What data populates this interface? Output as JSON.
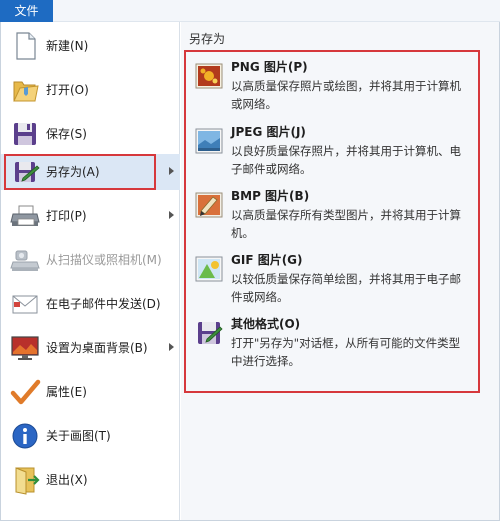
{
  "app": {
    "file_tab": "文件"
  },
  "menu": {
    "items": [
      {
        "label": "新建(N)",
        "icon": "new-document-icon"
      },
      {
        "label": "打开(O)",
        "icon": "folder-open-icon"
      },
      {
        "label": "保存(S)",
        "icon": "floppy-disk-icon"
      },
      {
        "label": "另存为(A)",
        "icon": "save-as-icon"
      },
      {
        "label": "打印(P)",
        "icon": "printer-icon"
      },
      {
        "label": "从扫描仪或照相机(M)",
        "icon": "scanner-icon"
      },
      {
        "label": "在电子邮件中发送(D)",
        "icon": "email-icon"
      },
      {
        "label": "设置为桌面背景(B)",
        "icon": "desktop-icon"
      },
      {
        "label": "属性(E)",
        "icon": "checkmark-icon"
      },
      {
        "label": "关于画图(T)",
        "icon": "info-icon"
      },
      {
        "label": "退出(X)",
        "icon": "exit-icon"
      }
    ]
  },
  "save_as": {
    "title": "另存为",
    "options": [
      {
        "title": "PNG 图片(P)",
        "desc": "以高质量保存照片或绘图，并将其用于计算机或网络。",
        "icon": "png-image-icon"
      },
      {
        "title": "JPEG 图片(J)",
        "desc": "以良好质量保存照片，并将其用于计算机、电子邮件或网络。",
        "icon": "jpeg-image-icon"
      },
      {
        "title": "BMP 图片(B)",
        "desc": "以高质量保存所有类型图片，并将其用于计算机。",
        "icon": "bmp-image-icon"
      },
      {
        "title": "GIF 图片(G)",
        "desc": "以较低质量保存简单绘图，并将其用于电子邮件或网络。",
        "icon": "gif-image-icon"
      },
      {
        "title": "其他格式(O)",
        "desc": "打开\"另存为\"对话框，从所有可能的文件类型中进行选择。",
        "icon": "other-formats-icon"
      }
    ]
  },
  "colors": {
    "accent": "#1e6bc2",
    "highlight_border": "#d6383c",
    "selected_bg": "#dbe7f5"
  }
}
